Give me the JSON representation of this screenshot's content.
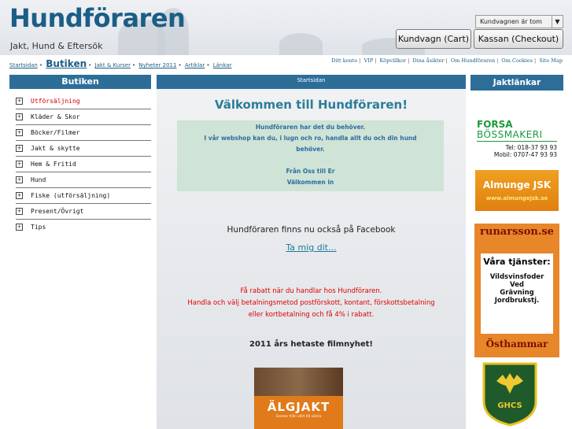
{
  "header": {
    "title": "Hundföraren",
    "subtitle": "Jakt, Hund & Eftersök",
    "cart_status": "Kundvagnen är tom",
    "cart_button": "Kundvagn (Cart)",
    "checkout_button": "Kassan (Checkout)"
  },
  "nav": {
    "left": [
      "Startsidan",
      "Butiken",
      "Jakt & Kurser",
      "Nyheter 2011",
      "Artiklar",
      "Länkar"
    ],
    "right": [
      "Ditt konto",
      "VIP",
      "Köpvillkor",
      "Dina åsikter",
      "Om Hundföraren",
      "Om Cookies",
      "Site Map"
    ]
  },
  "sidebar": {
    "heading": "Butiken",
    "categories": [
      {
        "label": "Utförsäljning",
        "highlight": true
      },
      {
        "label": "Kläder & Skor"
      },
      {
        "label": "Böcker/Filmer"
      },
      {
        "label": "Jakt & skytte"
      },
      {
        "label": "Hem & Fritid"
      },
      {
        "label": "Hund"
      },
      {
        "label": "Fiske (utförsäljning)"
      },
      {
        "label": "Present/Övrigt"
      },
      {
        "label": "Tips"
      }
    ]
  },
  "main": {
    "heading": "Startsidan",
    "welcome": "Välkommen till Hundföraren!",
    "info_lines": [
      "Hundföraren har det du behöver.",
      "I vår webshop kan du, i lugn och ro, handla allt du och din hund",
      "behöver.",
      "",
      "Från Oss till Er",
      "Välkommen in"
    ],
    "facebook_text": "Hundföraren finns nu också på Facebook",
    "facebook_link": "Ta mig dit...",
    "rabatt_lines": [
      "Få rabatt när du handlar hos Hundföraren.",
      "Handla och välj betalningsmetod postförskott, kontant, förskottsbetalning",
      "eller kortbetalning och få 4% i rabatt."
    ],
    "hottest": "2011 års hetaste filmnyhet!",
    "movie_title": "ÄLGJAKT",
    "movie_subtitle": "Scener från vårt till södra"
  },
  "right": {
    "heading": "Jaktlänkar",
    "forsa": {
      "line1": "FORSA",
      "line2": "BÖSSMAKERI",
      "tel": "Tel: 018-37 93 93",
      "mobil": "Mobil: 0707-47 93 93"
    },
    "almunge": {
      "title": "Almunge JSK",
      "url": "www.almungejsk.se"
    },
    "runarsson": {
      "top": "runarsson.se",
      "heading": "Våra tjänster:",
      "services": [
        "Vildsvinsfoder",
        "Ved",
        "Grävning",
        "Jordbrukstj."
      ],
      "bottom": "Östhammar"
    },
    "ghcs": {
      "text": "GHCS"
    }
  },
  "colors": {
    "accent": "#2d6e99",
    "title": "#1b5e86",
    "sale": "#d10000",
    "link": "#1b7a99"
  }
}
